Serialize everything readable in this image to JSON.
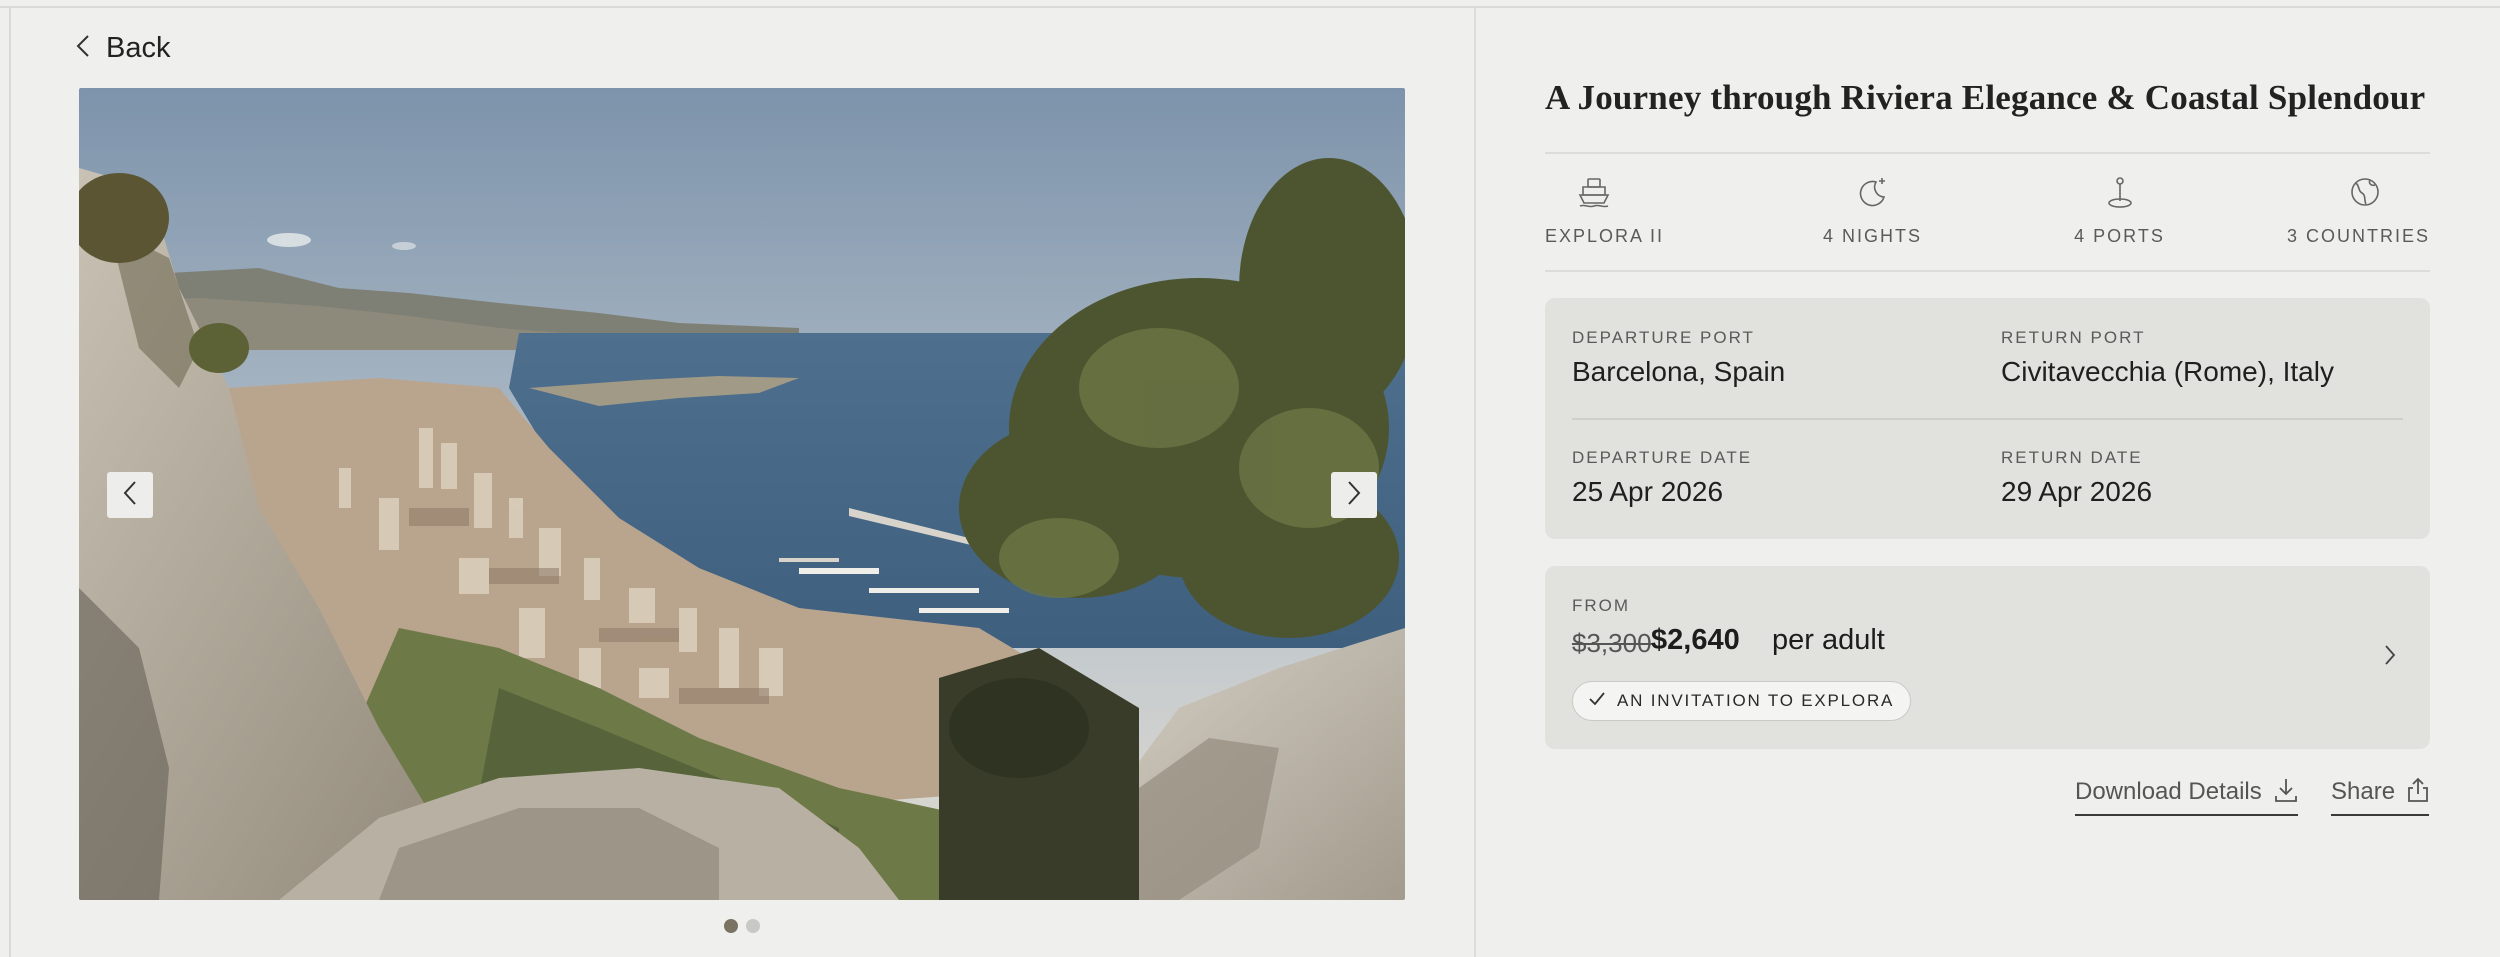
{
  "nav": {
    "back_label": "Back"
  },
  "gallery": {
    "image_alt": "Aerial view of Monaco coastline from rocky cliffs",
    "total_slides": 2,
    "active_slide": 1
  },
  "voyage": {
    "title": "A Journey through Riviera Elegance & Coastal Splendour",
    "stats": [
      {
        "icon": "ship-icon",
        "label": "EXPLORA II"
      },
      {
        "icon": "moon-star-icon",
        "label": "4 NIGHTS"
      },
      {
        "icon": "anchor-pin-icon",
        "label": "4 PORTS"
      },
      {
        "icon": "globe-icon",
        "label": "3 COUNTRIES"
      }
    ]
  },
  "itinerary": {
    "departure_port_label": "DEPARTURE PORT",
    "departure_port": "Barcelona, Spain",
    "return_port_label": "RETURN PORT",
    "return_port": "Civitavecchia (Rome), Italy",
    "departure_date_label": "DEPARTURE DATE",
    "departure_date": "25 Apr 2026",
    "return_date_label": "RETURN DATE",
    "return_date": "29 Apr 2026"
  },
  "pricing": {
    "from_label": "FROM",
    "original_price": "$3,300",
    "price": "$2,640",
    "unit": "per adult",
    "offer_badge": "AN INVITATION TO EXPLORA"
  },
  "actions": {
    "download_label": "Download Details",
    "share_label": "Share"
  },
  "colors": {
    "page_bg": "#efefee",
    "card_bg": "#e1e1dd",
    "dot_active": "#7a7262"
  }
}
